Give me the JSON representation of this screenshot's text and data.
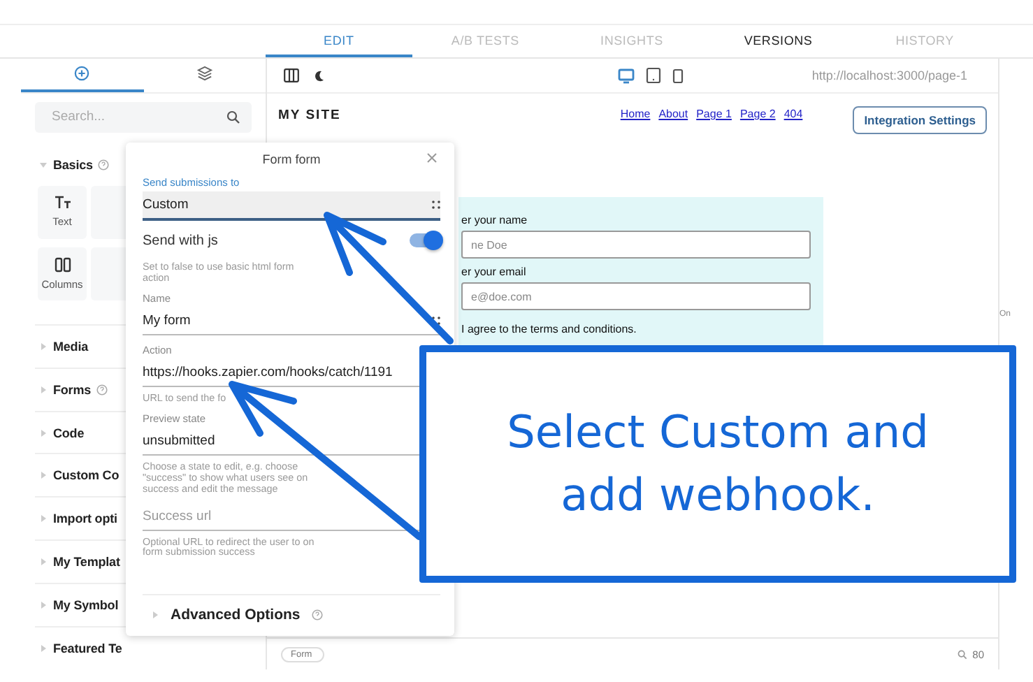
{
  "top_tabs": [
    {
      "label": "EDIT",
      "selected": true,
      "disabled": false
    },
    {
      "label": "A/B TESTS",
      "selected": false,
      "disabled": true
    },
    {
      "label": "INSIGHTS",
      "selected": false,
      "disabled": true
    },
    {
      "label": "VERSIONS",
      "selected": false,
      "disabled": false
    },
    {
      "label": "HISTORY",
      "selected": false,
      "disabled": true
    }
  ],
  "sidebar": {
    "tabs": [
      {
        "kind": "add",
        "selected": true
      },
      {
        "kind": "layers",
        "selected": false
      }
    ],
    "search": {
      "placeholder": "Search..."
    },
    "sections": [
      {
        "label": "Basics",
        "expanded": true,
        "help": true,
        "blocks": [
          {
            "kind": "text",
            "label": "Text"
          },
          {
            "kind": "blank"
          },
          {
            "kind": "columns",
            "label": "Columns"
          },
          {
            "kind": "blank"
          }
        ]
      },
      {
        "label": "Media",
        "expanded": false
      },
      {
        "label": "Forms",
        "expanded": false,
        "help": true
      },
      {
        "label": "Code",
        "expanded": false
      },
      {
        "label": "Custom Co",
        "expanded": false
      },
      {
        "label": "Import opti",
        "expanded": false
      },
      {
        "label": "My Templat",
        "expanded": false
      },
      {
        "label": "My Symbol",
        "expanded": false
      },
      {
        "label": "Featured Te",
        "expanded": false
      }
    ]
  },
  "canvas": {
    "devices": [
      {
        "kind": "desktop",
        "selected": true
      },
      {
        "kind": "tablet",
        "selected": false
      },
      {
        "kind": "phone",
        "selected": false
      }
    ],
    "url": "http://localhost:3000/page-1",
    "site_title": "MY SITE",
    "nav_links": [
      "Home",
      "About",
      "Page 1",
      "Page 2",
      "404"
    ],
    "integration_button": "Integration Settings",
    "form": {
      "name_label": "er your name",
      "name_placeholder": "ne Doe",
      "email_label": "er your email",
      "email_placeholder": "e@doe.com",
      "agree_text": "I agree to the terms and conditions."
    },
    "breadcrumb": "Form",
    "zoom": "80"
  },
  "right_panel": {
    "text": "On"
  },
  "dialog": {
    "title": "Form form",
    "fields": [
      {
        "kind": "select",
        "label": "Send submissions to",
        "value": "Custom",
        "focused": true,
        "handle": true
      },
      {
        "kind": "toggle",
        "label": "Send with js",
        "on": true,
        "help": "Set to false to use basic html form action"
      },
      {
        "kind": "text",
        "label": "Name",
        "value": "My form",
        "focused": false,
        "handle": true
      },
      {
        "kind": "text",
        "label": "Action",
        "value": "https://hooks.zapier.com/hooks/catch/1191",
        "focused": false,
        "handle": false,
        "help": "URL to send the fo"
      },
      {
        "kind": "text",
        "label": "Preview state",
        "value": "unsubmitted",
        "focused": false,
        "handle": false,
        "help": "Choose a state to edit, e.g. choose \"success\" to show what users see on success and edit the message"
      },
      {
        "kind": "text",
        "placeholder": "Success url",
        "focused": false,
        "handle": false,
        "help": "Optional URL to redirect the user to on form submission success"
      }
    ],
    "advanced": {
      "label": "Advanced Options",
      "expanded": false
    }
  },
  "annotation": {
    "text": "Select Custom and add webhook."
  }
}
